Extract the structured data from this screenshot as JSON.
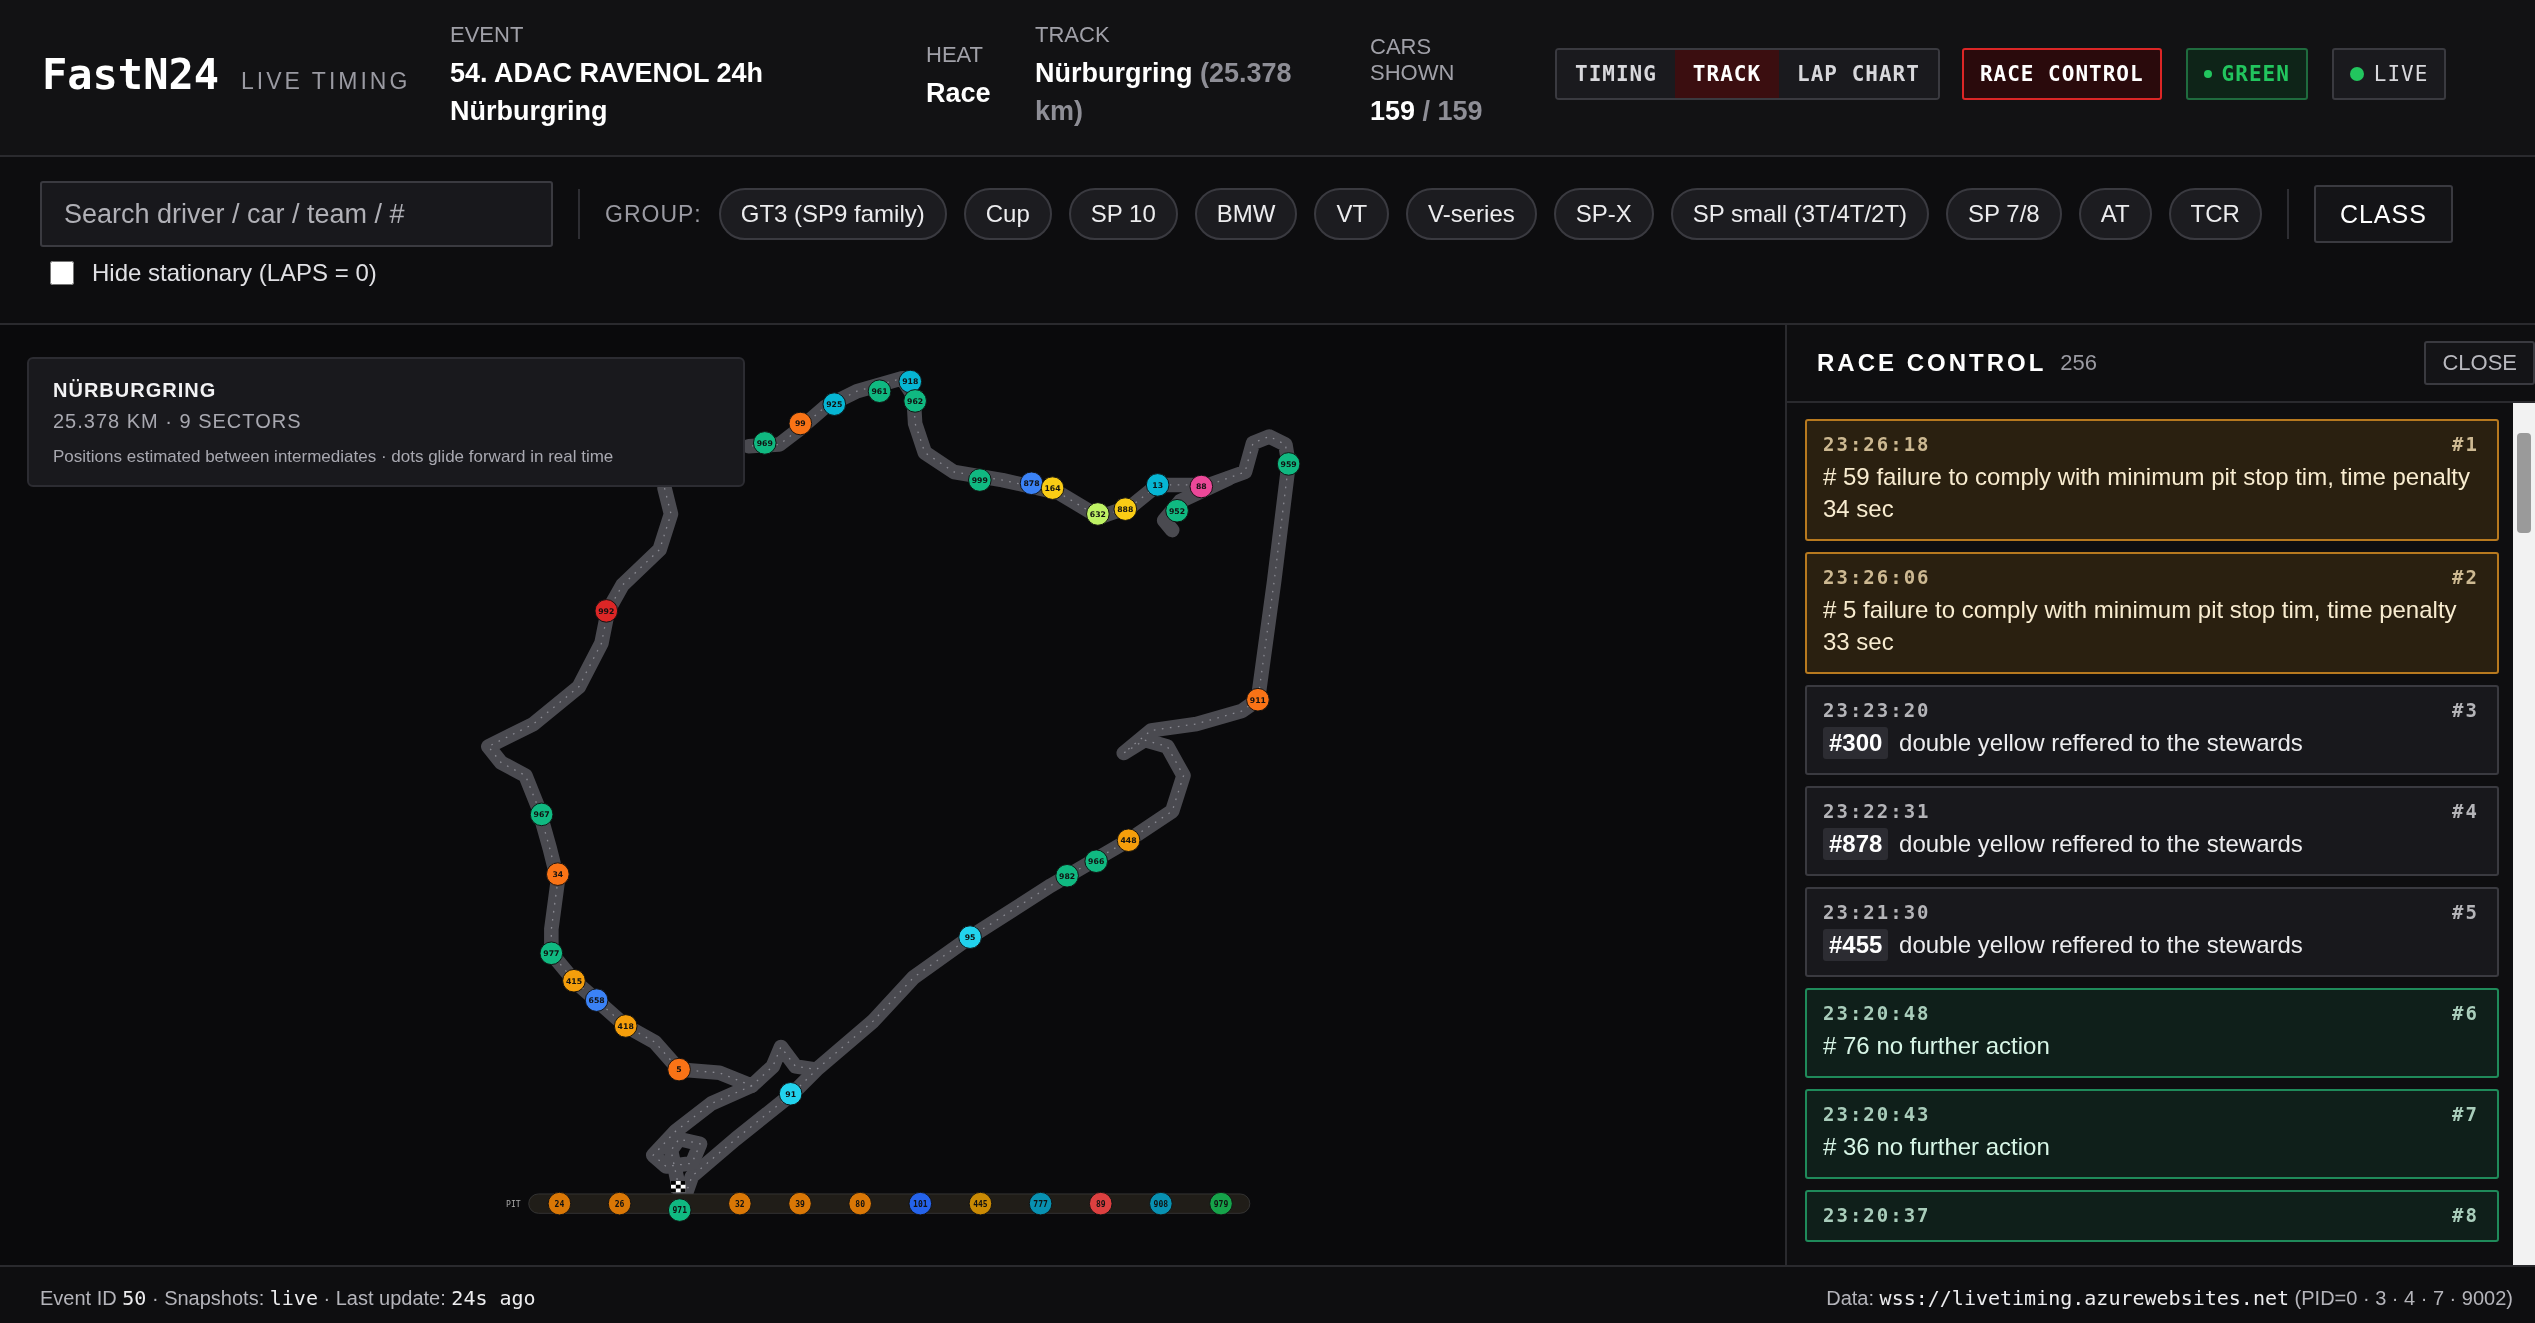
{
  "header": {
    "logo": "FastN24",
    "subtitle": "LIVE TIMING",
    "event": {
      "label": "EVENT",
      "value": "54. ADAC RAVENOL 24h Nürburgring"
    },
    "heat": {
      "label": "HEAT",
      "value": "Race"
    },
    "track": {
      "label": "TRACK",
      "name": "Nürburgring",
      "length": "(25.378 km)"
    },
    "cars": {
      "label": "CARS SHOWN",
      "shown": "159",
      "total": "/ 159"
    }
  },
  "view_tabs": [
    {
      "label": "TIMING",
      "selected": false
    },
    {
      "label": "TRACK",
      "selected": true
    },
    {
      "label": "LAP CHART",
      "selected": false
    }
  ],
  "race_control_button": {
    "label": "RACE CONTROL",
    "on": true
  },
  "flag": {
    "label": "GREEN",
    "color": "#22c55e"
  },
  "live": {
    "label": "LIVE",
    "on": true
  },
  "filters": {
    "search": {
      "placeholder": "Search driver / car / team / #"
    },
    "group_label": "GROUP:",
    "groups": [
      {
        "label": "GT3 (SP9 family)",
        "selected": false
      },
      {
        "label": "Cup",
        "selected": false
      },
      {
        "label": "SP 10",
        "selected": false
      },
      {
        "label": "BMW",
        "selected": false
      },
      {
        "label": "VT",
        "selected": false
      },
      {
        "label": "V-series",
        "selected": false
      },
      {
        "label": "SP-X",
        "selected": false
      },
      {
        "label": "SP small (3T/4T/2T)",
        "selected": false
      },
      {
        "label": "SP 7/8",
        "selected": false
      },
      {
        "label": "AT",
        "selected": false
      },
      {
        "label": "TCR",
        "selected": false
      }
    ],
    "class_button": "CLASS",
    "hide_stationary": {
      "label": "Hide stationary (LAPS = 0)",
      "checked": false
    }
  },
  "map": {
    "info": {
      "title": "NÜRBURGRING",
      "subtitle": "25.378 KM · 9 SECTORS",
      "note": "Positions estimated between intermediates · dots glide forward in real time"
    },
    "cars": [
      {
        "number": "969",
        "color": "#10b981"
      },
      {
        "number": "99",
        "color": "#f97316"
      },
      {
        "number": "925",
        "color": "#06b6d4"
      },
      {
        "number": "961",
        "color": "#10b981"
      },
      {
        "number": "918",
        "color": "#06b6d4"
      },
      {
        "number": "962",
        "color": "#10b981"
      },
      {
        "number": "999",
        "color": "#10b981"
      },
      {
        "number": "878",
        "color": "#3b82f6"
      },
      {
        "number": "164",
        "color": "#facc15"
      },
      {
        "number": "632",
        "color": "#bef264"
      },
      {
        "number": "888",
        "color": "#facc15"
      },
      {
        "number": "13",
        "color": "#06b6d4"
      },
      {
        "number": "88",
        "color": "#ec4899"
      },
      {
        "number": "952",
        "color": "#10b981"
      },
      {
        "number": "959",
        "color": "#10b981"
      },
      {
        "number": "911",
        "color": "#f97316"
      },
      {
        "number": "448",
        "color": "#f59e0b"
      },
      {
        "number": "982",
        "color": "#10b981"
      },
      {
        "number": "966",
        "color": "#10b981"
      },
      {
        "number": "95",
        "color": "#22d3ee"
      },
      {
        "number": "91",
        "color": "#22d3ee"
      },
      {
        "number": "992",
        "color": "#dc2626"
      },
      {
        "number": "967",
        "color": "#10b981"
      },
      {
        "number": "34",
        "color": "#f97316"
      },
      {
        "number": "977",
        "color": "#10b981"
      },
      {
        "number": "415",
        "color": "#f59e0b"
      },
      {
        "number": "658",
        "color": "#3b82f6"
      },
      {
        "number": "418",
        "color": "#f59e0b"
      },
      {
        "number": "5",
        "color": "#f97316"
      }
    ],
    "pit": {
      "label": "PIT",
      "cars": [
        {
          "number": "24",
          "color": "#d97706"
        },
        {
          "number": "26",
          "color": "#d97706"
        },
        {
          "number": "971",
          "color": "#10b981"
        },
        {
          "number": "32",
          "color": "#d97706"
        },
        {
          "number": "39",
          "color": "#d97706"
        },
        {
          "number": "80",
          "color": "#d97706"
        },
        {
          "number": "101",
          "color": "#2563eb"
        },
        {
          "number": "445",
          "color": "#ca8a04"
        },
        {
          "number": "777",
          "color": "#0891b2"
        },
        {
          "number": "89",
          "color": "#dc4040"
        },
        {
          "number": "908",
          "color": "#0891b2"
        },
        {
          "number": "979",
          "color": "#16a34a"
        }
      ]
    }
  },
  "race_control": {
    "title": "RACE CONTROL",
    "count": "256",
    "close": "CLOSE",
    "messages": [
      {
        "kind": "penalty",
        "time": "23:26:18",
        "index": "#1",
        "text": "# 59 failure to comply with minimum pit stop tim, time penalty 34 sec"
      },
      {
        "kind": "penalty",
        "time": "23:26:06",
        "index": "#2",
        "text": "# 5 failure to comply with minimum pit stop tim, time penalty 33 sec"
      },
      {
        "kind": "report",
        "time": "23:23:20",
        "index": "#3",
        "car": "#300",
        "text": "double yellow reffered to the stewards"
      },
      {
        "kind": "report",
        "time": "23:22:31",
        "index": "#4",
        "car": "#878",
        "text": "double yellow reffered to the stewards"
      },
      {
        "kind": "report",
        "time": "23:21:30",
        "index": "#5",
        "car": "#455",
        "text": "double yellow reffered to the stewards"
      },
      {
        "kind": "decision",
        "time": "23:20:48",
        "index": "#6",
        "text": "# 76 no further action"
      },
      {
        "kind": "decision",
        "time": "23:20:43",
        "index": "#7",
        "text": "# 36 no further action"
      },
      {
        "kind": "decision",
        "time": "23:20:37",
        "index": "#8"
      }
    ]
  },
  "footer": {
    "left": [
      {
        "kind": "plain",
        "text": "Event ID "
      },
      {
        "kind": "mono",
        "text": "50"
      },
      {
        "kind": "plain",
        "text": " · Snapshots: "
      },
      {
        "kind": "mono",
        "text": "live"
      },
      {
        "kind": "plain",
        "text": " · Last update: "
      },
      {
        "kind": "mono",
        "text": "24s ago"
      }
    ],
    "right": [
      {
        "kind": "plain",
        "text": "Data: "
      },
      {
        "kind": "mono",
        "text": "wss://livetiming.azurewebsites.net"
      },
      {
        "kind": "plain",
        "text": " (PID=0 · 3 · 4 · 7 · 9002)"
      }
    ]
  }
}
